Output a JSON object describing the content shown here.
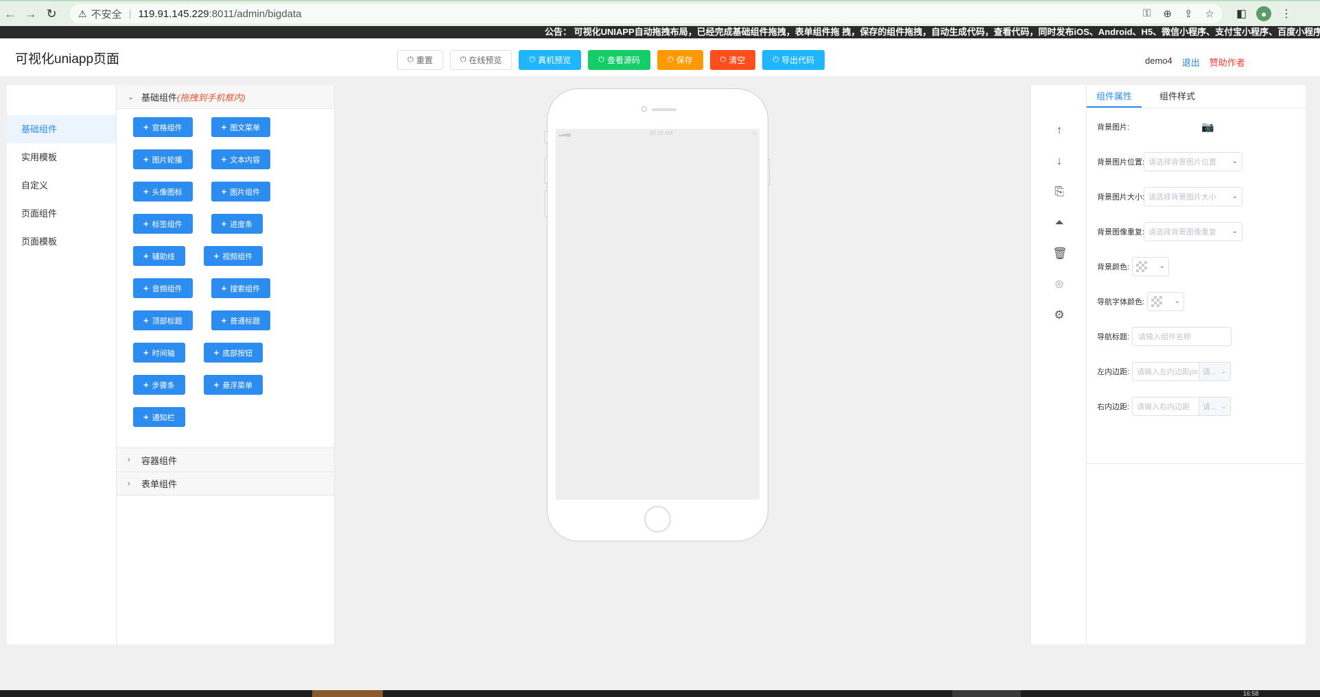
{
  "browser": {
    "insecure_label": "不安全",
    "url_host": "119.91.145.229",
    "url_path": ":8011/admin/bigdata"
  },
  "notice": {
    "text": "公告：  可视化UNIAPP自动拖拽布局，已经完成基础组件拖拽，表单组件拖 拽，保存的组件拖拽，自动生成代码，查看代码，同时发布iOS、Android、H5、微信小程序、支付宝小程序、百度小程序、头条"
  },
  "header": {
    "title": "可视化uniapp页面",
    "toolbar": {
      "reset": "重置",
      "online_preview": "在线预览",
      "device_preview": "真机预览",
      "view_source": "查看源码",
      "save": "保存",
      "clear": "清空",
      "export_code": "导出代码"
    },
    "user": "demo4",
    "logout": "退出",
    "sponsor": "赞助作者"
  },
  "left_nav": {
    "items": [
      {
        "label": "基础组件"
      },
      {
        "label": "实用模板"
      },
      {
        "label": "自定义"
      },
      {
        "label": "页面组件"
      },
      {
        "label": "页面模板"
      }
    ]
  },
  "components": {
    "basic_title": "基础组件",
    "basic_hint": "(拖拽到手机框内)",
    "buttons": [
      "宫格组件",
      "图文菜单",
      "图片轮播",
      "文本内容",
      "头像图标",
      "图片组件",
      "标签组件",
      "进度条",
      "辅助线",
      "视频组件",
      "音频组件",
      "搜索组件",
      "顶部标题",
      "普通标题",
      "时间轴",
      "底部按钮",
      "步骤条",
      "悬浮菜单",
      "通知栏"
    ],
    "container_title": "容器组件",
    "form_title": "表单组件"
  },
  "phone": {
    "status_time": "09:15 AM"
  },
  "props": {
    "tabs": [
      "组件属性",
      "组件样式"
    ],
    "labels": {
      "bg_image": "背景图片:",
      "bg_position": "背景图片位置:",
      "bg_size": "背景图片大小:",
      "bg_repeat": "背景图像重复:",
      "bg_color": "背景颜色:",
      "nav_font_color": "导航字体颜色:",
      "nav_title": "导航标题:",
      "padding_left": "左内边距:",
      "padding_right": "右内边距:"
    },
    "placeholders": {
      "bg_position": "请选择背景图片位置",
      "bg_size": "请选择背景图片大小",
      "bg_repeat": "请选择背景图像重复",
      "nav_title": "请输入组件名称",
      "padding_left": "请输入左内边距px",
      "padding_right": "请输入右内边距",
      "unit": "请..."
    }
  },
  "taskbar": {
    "clock": "16:58"
  },
  "colors": {
    "primary": "#2d8cf0",
    "cyan": "#1fb6ff",
    "green": "#13ce66",
    "orange": "#ff9900",
    "red": "#ff4d1c",
    "hint": "#e4572e"
  },
  "icons": [
    "back-arrow-icon",
    "forward-arrow-icon",
    "reload-icon",
    "warning-icon",
    "key-icon",
    "zoom-icon",
    "share-icon",
    "star-icon",
    "sidebar-icon",
    "profile-icon",
    "menu-dots-icon",
    "camera-icon",
    "arrow-up-icon",
    "arrow-down-icon",
    "copy-icon",
    "top-icon",
    "trash-icon",
    "aperture-icon",
    "gear-icon"
  ]
}
